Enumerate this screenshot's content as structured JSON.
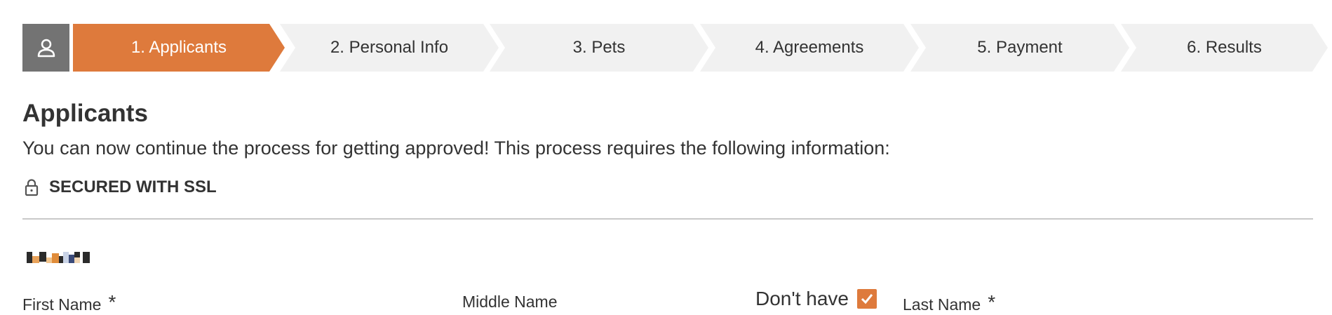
{
  "stepper": {
    "steps": [
      {
        "label": "1. Applicants"
      },
      {
        "label": "2. Personal Info"
      },
      {
        "label": "3. Pets"
      },
      {
        "label": "4. Agreements"
      },
      {
        "label": "5. Payment"
      },
      {
        "label": "6. Results"
      }
    ],
    "active_index": 0,
    "user_icon": "user-icon"
  },
  "page": {
    "title": "Applicants",
    "intro": "You can now continue the process for getting approved! This process requires the following information:",
    "secure_label": "SECURED WITH SSL",
    "secure_icon": "lock-icon"
  },
  "form": {
    "first_name_label": "First Name",
    "middle_name_label": "Middle Name",
    "dont_have_label": "Don't have",
    "dont_have_checked": true,
    "last_name_label": "Last Name",
    "required_mark": "*"
  },
  "colors": {
    "accent": "#de7a3c",
    "step_bg": "#f1f1f1",
    "user_box": "#737373",
    "text": "#333333"
  }
}
